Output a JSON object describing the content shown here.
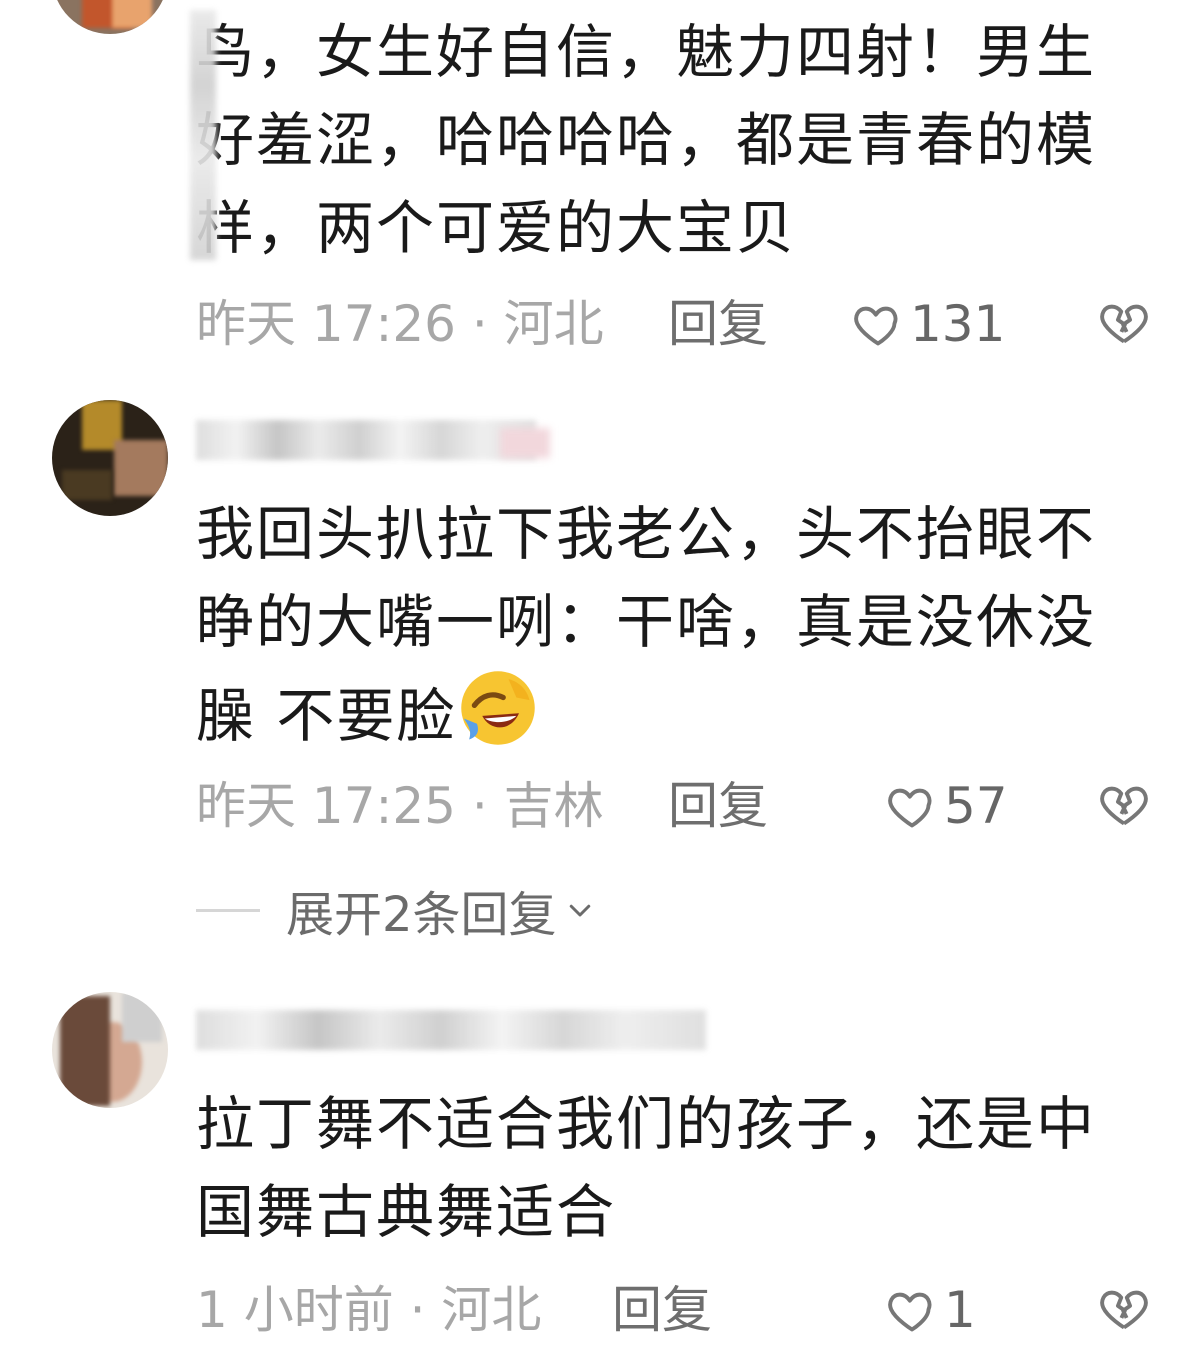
{
  "comments": [
    {
      "text_lines": [
        "鸟，女生好自信，魅力四射！男生",
        "好羞涩，哈哈哈哈，都是青春的模",
        "样，两个可爱的大宝贝"
      ],
      "time_location": "昨天 17:26 · 河北",
      "reply_label": "回复",
      "like_count": "131"
    },
    {
      "text_lines": [
        "我回头扒拉下我老公，头不抬眼不",
        "睁的大嘴一咧：干啥，真是没休没",
        "臊 不要脸"
      ],
      "emoji": "rolling-on-floor-laughing",
      "time_location": "昨天 17:25 · 吉林",
      "reply_label": "回复",
      "like_count": "57",
      "expand_label": "展开2条回复"
    },
    {
      "text_lines": [
        "拉丁舞不适合我们的孩子，还是中",
        "国舞古典舞适合"
      ],
      "time_location": "1 小时前 · 河北",
      "reply_label": "回复",
      "like_count": "1"
    }
  ],
  "colors": {
    "text": "#1a1a1a",
    "meta": "#a7a7a7",
    "reply": "#6e6e6e",
    "icon": "#777777"
  }
}
